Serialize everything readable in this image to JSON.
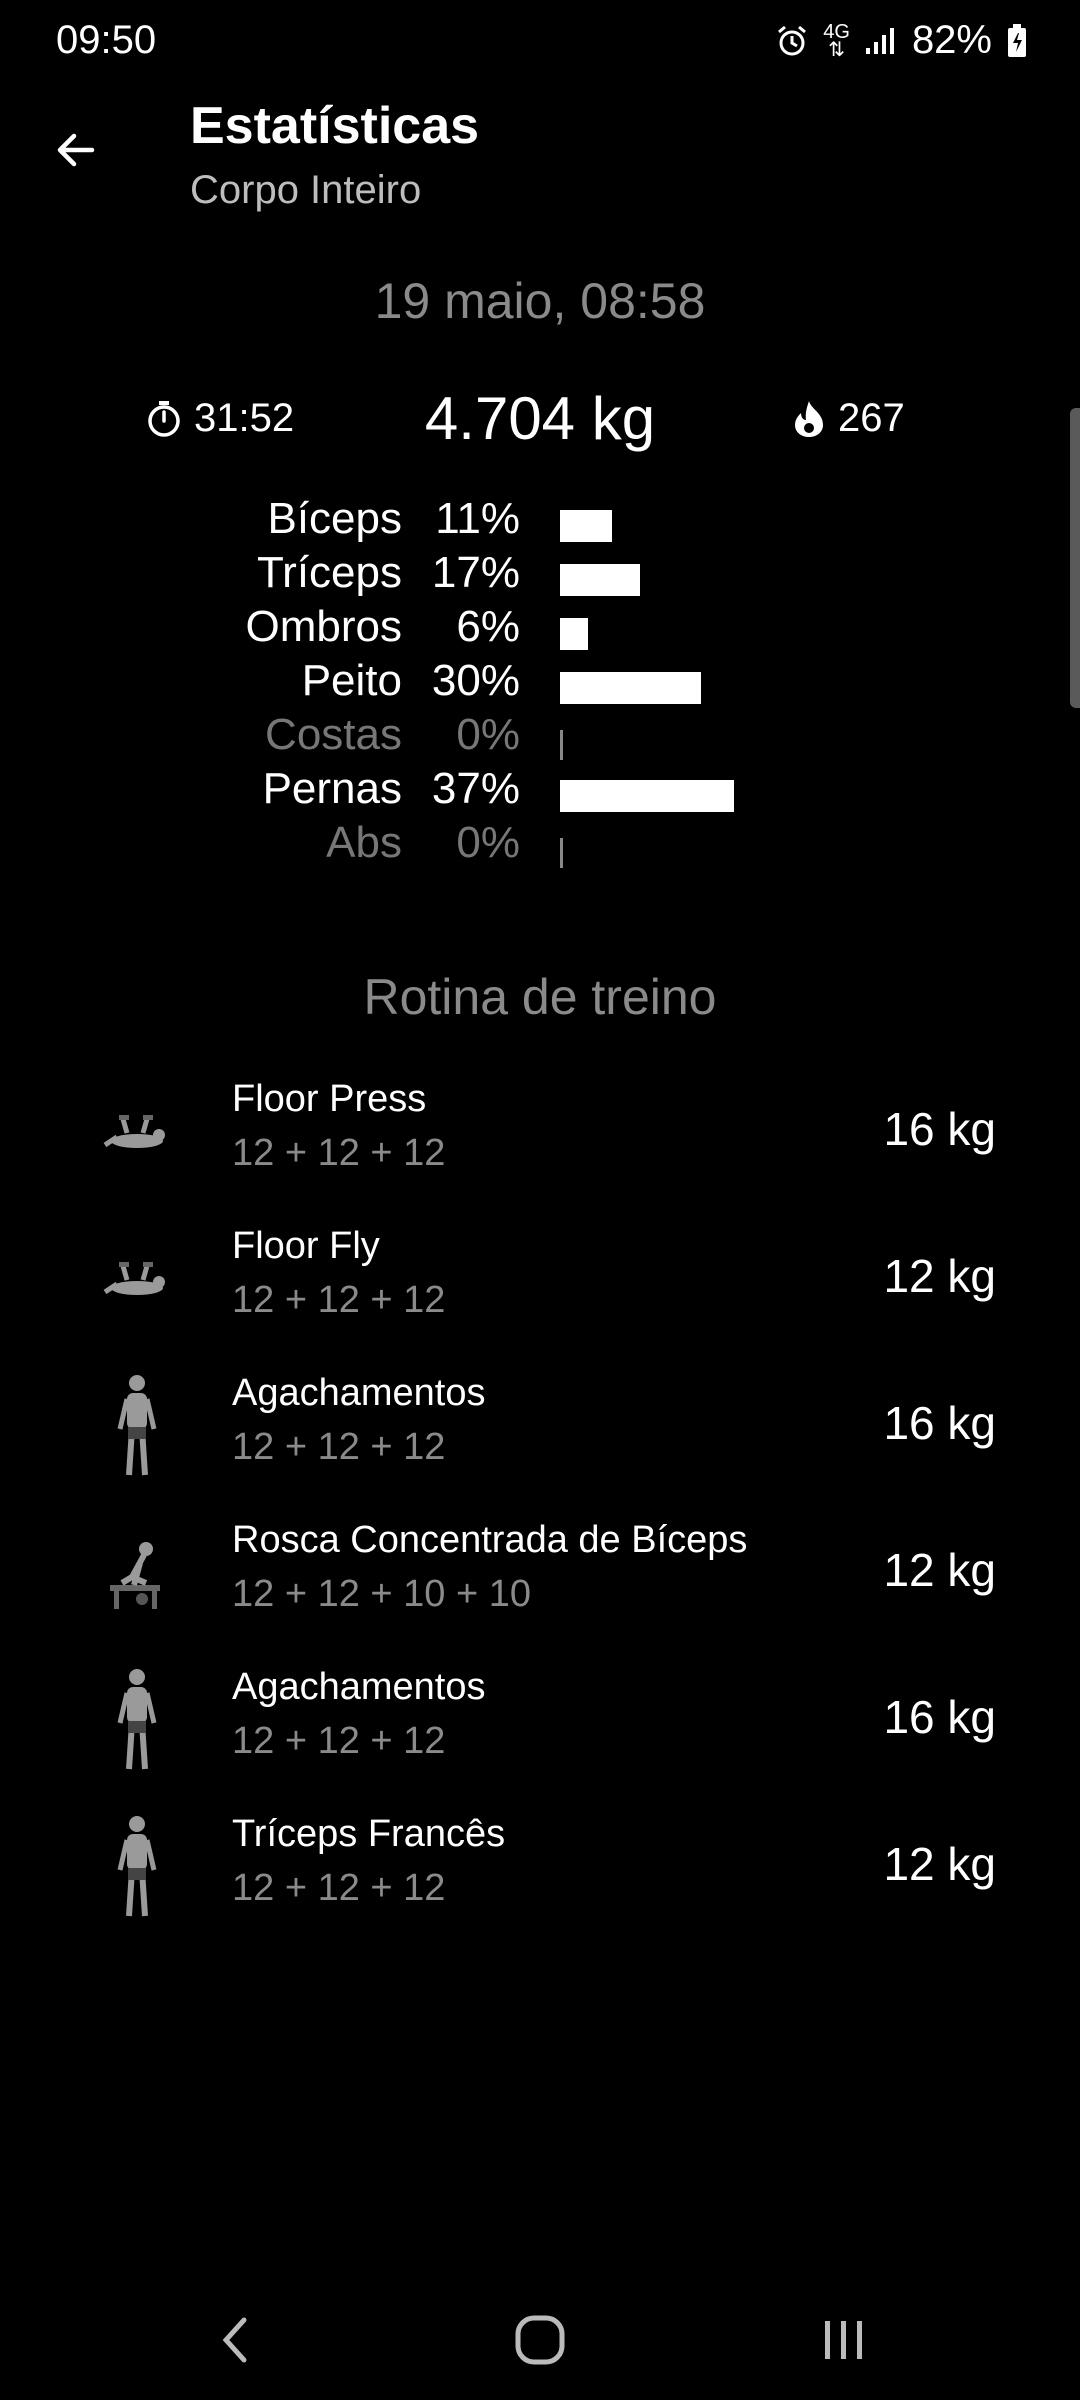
{
  "status_bar": {
    "time": "09:50",
    "network": "4G",
    "battery": "82%",
    "icons": [
      "alarm-icon",
      "network-4g-icon",
      "signal-icon",
      "battery-icon"
    ]
  },
  "header": {
    "title": "Estatísticas",
    "subtitle": "Corpo Inteiro",
    "back_icon": "back-arrow-icon"
  },
  "session": {
    "date": "19 maio, 08:58",
    "duration": "31:52",
    "total_weight": "4.704 kg",
    "calories": "267"
  },
  "muscles": [
    {
      "name": "Bíceps",
      "percent_label": "11%",
      "percent": 11
    },
    {
      "name": "Tríceps",
      "percent_label": "17%",
      "percent": 17
    },
    {
      "name": "Ombros",
      "percent_label": "6%",
      "percent": 6
    },
    {
      "name": "Peito",
      "percent_label": "30%",
      "percent": 30
    },
    {
      "name": "Costas",
      "percent_label": "0%",
      "percent": 0
    },
    {
      "name": "Pernas",
      "percent_label": "37%",
      "percent": 37
    },
    {
      "name": "Abs",
      "percent_label": "0%",
      "percent": 0
    }
  ],
  "routine": {
    "title": "Rotina de treino",
    "exercises": [
      {
        "name": "Floor Press",
        "reps": "12 + 12 + 12",
        "weight": "16 kg",
        "icon": "floor-press-figure-icon"
      },
      {
        "name": "Floor Fly",
        "reps": "12 + 12 + 12",
        "weight": "12 kg",
        "icon": "floor-fly-figure-icon"
      },
      {
        "name": "Agachamentos",
        "reps": "12 + 12 + 12",
        "weight": "16 kg",
        "icon": "squat-figure-icon"
      },
      {
        "name": "Rosca Concentrada de Bíceps",
        "reps": "12 + 12 + 10 + 10",
        "weight": "12 kg",
        "icon": "bicep-curl-figure-icon"
      },
      {
        "name": "Agachamentos",
        "reps": "12 + 12 + 12",
        "weight": "16 kg",
        "icon": "squat-figure-icon"
      },
      {
        "name": "Tríceps Francês",
        "reps": "12 + 12 + 12",
        "weight": "12 kg",
        "icon": "triceps-figure-icon"
      }
    ]
  },
  "colors": {
    "background": "#000000",
    "text_primary": "#ffffff",
    "text_secondary": "#8a8a8a",
    "bar": "#ffffff"
  }
}
